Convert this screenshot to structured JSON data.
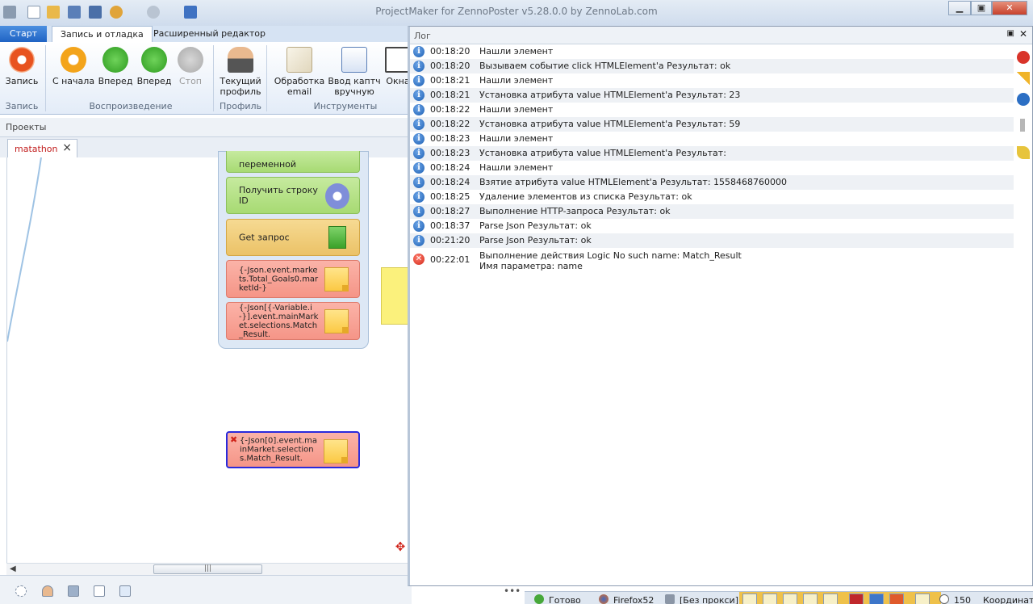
{
  "window": {
    "title": "ProjectMaker for ZennoPoster v5.28.0.0 by ZennoLab.com"
  },
  "ribbon": {
    "tabs": [
      {
        "label": "Старт"
      },
      {
        "label": "Запись и отладка"
      },
      {
        "label": "Расширенный редактор"
      }
    ],
    "buttons": {
      "record": "Запись",
      "from_start": "С начала",
      "forward": "Вперед",
      "forward2": "Вперед",
      "stop": "Стоп",
      "current_profile": "Текущий профиль",
      "email_processing": "Обработка email",
      "captcha_manual": "Ввод каптч вручную",
      "windows": "Окна"
    },
    "groups": {
      "record": "Запись",
      "playback": "Воспроизведение",
      "profile": "Профиль",
      "tools": "Инструменты"
    }
  },
  "projects": {
    "header": "Проекты",
    "tab": "matathon"
  },
  "canvas": {
    "actions": [
      {
        "text": "переменной",
        "style": "green"
      },
      {
        "text": "Получить строку ID",
        "style": "green"
      },
      {
        "text": "Get запрос",
        "style": "orange"
      },
      {
        "text": "{-Json.event.markets.Total_Goals0.marketId-}",
        "style": "red"
      },
      {
        "text": "{-Json[{-Variable.i-}].event.mainMarket.selections.Match_Result.",
        "style": "red"
      },
      {
        "text": "{-Json[0].event.mainMarket.selections.Match_Result.",
        "style": "red"
      }
    ]
  },
  "log": {
    "title": "Лог",
    "rows": [
      {
        "time": "00:18:20",
        "msg": "Нашли элемент",
        "type": "info"
      },
      {
        "time": "00:18:20",
        "msg": "Вызываем событие click HTMLElement'a  Результат: ok",
        "type": "info"
      },
      {
        "time": "00:18:21",
        "msg": "Нашли элемент",
        "type": "info"
      },
      {
        "time": "00:18:21",
        "msg": "Установка атрибута value HTMLElement'a  Результат: 23",
        "type": "info"
      },
      {
        "time": "00:18:22",
        "msg": "Нашли элемент",
        "type": "info"
      },
      {
        "time": "00:18:22",
        "msg": "Установка атрибута value HTMLElement'a  Результат: 59",
        "type": "info"
      },
      {
        "time": "00:18:23",
        "msg": "Нашли элемент",
        "type": "info"
      },
      {
        "time": "00:18:23",
        "msg": "Установка атрибута value HTMLElement'a  Результат:",
        "type": "info"
      },
      {
        "time": "00:18:24",
        "msg": "Нашли элемент",
        "type": "info"
      },
      {
        "time": "00:18:24",
        "msg": "Взятие атрибута value HTMLElement'a  Результат: 1558468760000",
        "type": "info"
      },
      {
        "time": "00:18:25",
        "msg": "Удаление элементов из списка  Результат: ok",
        "type": "info"
      },
      {
        "time": "00:18:27",
        "msg": "Выполнение HTTP-запроса  Результат: ok",
        "type": "info"
      },
      {
        "time": "00:18:37",
        "msg": "Parse Json  Результат: ok",
        "type": "info"
      },
      {
        "time": "00:21:20",
        "msg": "Parse Json  Результат: ok",
        "type": "info"
      }
    ],
    "error_row": {
      "time": "00:22:01",
      "msg1": "Выполнение действия Logic No such name: Match_Result",
      "msg2": "Имя параметра: name"
    }
  },
  "status": {
    "ready": "Готово",
    "browser": "Firefox52",
    "proxy": "[Без прокси]",
    "count": "150",
    "coords": "Координаты м"
  }
}
